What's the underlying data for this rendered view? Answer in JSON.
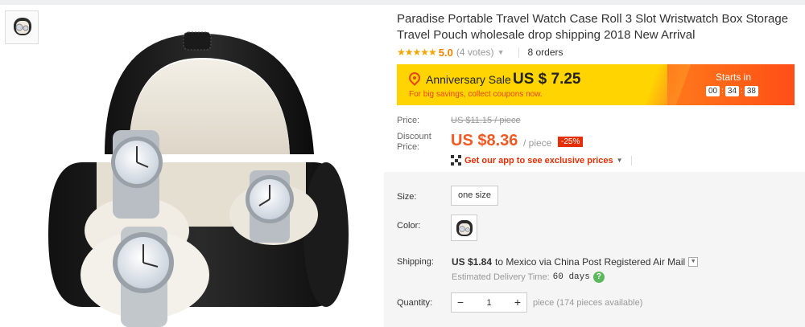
{
  "product": {
    "title": "Paradise Portable Travel Watch Case Roll 3 Slot Wristwatch Box Storage Travel Pouch wholesale drop shipping 2018 New Arrival",
    "stars": "★★★★★",
    "rating": "5.0",
    "votes": "(4 votes)",
    "orders": "8 orders"
  },
  "sale": {
    "name": "Anniversary Sale",
    "price": "US $ 7.25",
    "note": "For big savings, collect coupons now.",
    "starts_in": "Starts in",
    "timer": [
      "00",
      "34",
      "38"
    ]
  },
  "pricing": {
    "price_label": "Price:",
    "old_price": "US $11.15 / piece",
    "discount_label": "Discount Price:",
    "discount_price": "US $8.36",
    "per_piece": "/ piece",
    "discount_badge": "-25%",
    "app_promo": "Get our app to see exclusive prices"
  },
  "options": {
    "size_label": "Size:",
    "size_value": "one size",
    "color_label": "Color:",
    "shipping_label": "Shipping:",
    "shipping_cost": "US $1.84",
    "shipping_to": "to Mexico via China Post Registered Air Mail",
    "est_label": "Estimated Delivery Time:",
    "est_days": "60 days",
    "quantity_label": "Quantity:",
    "quantity_value": "1",
    "quantity_avail": "piece (174 pieces available)"
  },
  "colors": {
    "sale_yellow": "#ffd400",
    "sale_orange": "#ff5a17",
    "price_orange": "#f15a22",
    "badge_red": "#e62e04"
  }
}
